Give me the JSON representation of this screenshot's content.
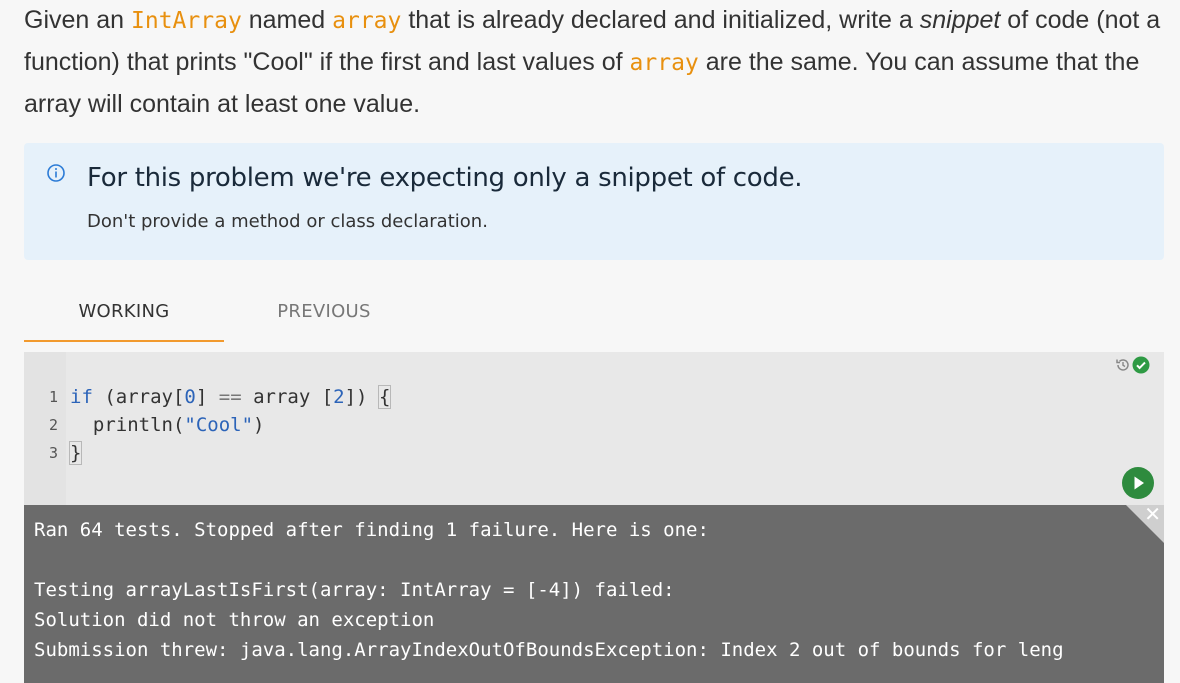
{
  "prompt": {
    "p1": "Given an ",
    "type_name": "IntArray",
    "p2": " named ",
    "var_name": "array",
    "p3": " that is already declared and initialized, write a ",
    "emph": "snippet",
    "p4": " of code (not a function) that prints \"Cool\" if the first and last values of ",
    "var_name_2": "array",
    "p5": " are the same. You can assume that the array will contain at least one value."
  },
  "info": {
    "title": "For this problem we're expecting only a snippet of code.",
    "subtitle": "Don't provide a method or class declaration.",
    "icon": "info-circle-icon"
  },
  "tabs": [
    {
      "label": "WORKING",
      "active": true
    },
    {
      "label": "PREVIOUS",
      "active": false
    }
  ],
  "editor": {
    "line_numbers": [
      "1",
      "2",
      "3"
    ],
    "line1": {
      "kw": "if",
      "a": " (array[",
      "n1": "0",
      "b": "] ",
      "op": "==",
      "c": " array [",
      "n2": "2",
      "d": "]) ",
      "brace": "{"
    },
    "line2": {
      "indent": "  ",
      "a": "println(",
      "str": "\"Cool\"",
      "b": ")"
    },
    "line3": {
      "brace": "}"
    },
    "history_icon": "history-icon",
    "status_icon": "check-circle-icon",
    "run_icon": "play-icon",
    "accent_color": "#2e8b3e"
  },
  "output": {
    "line1": "Ran 64 tests. Stopped after finding 1 failure. Here is one:",
    "line2": "Testing arrayLastIsFirst(array: IntArray = [-4]) failed:",
    "line3": "Solution did not throw an exception",
    "line4": "Submission threw: java.lang.ArrayIndexOutOfBoundsException: Index 2 out of bounds for leng",
    "close_icon": "close-icon"
  }
}
